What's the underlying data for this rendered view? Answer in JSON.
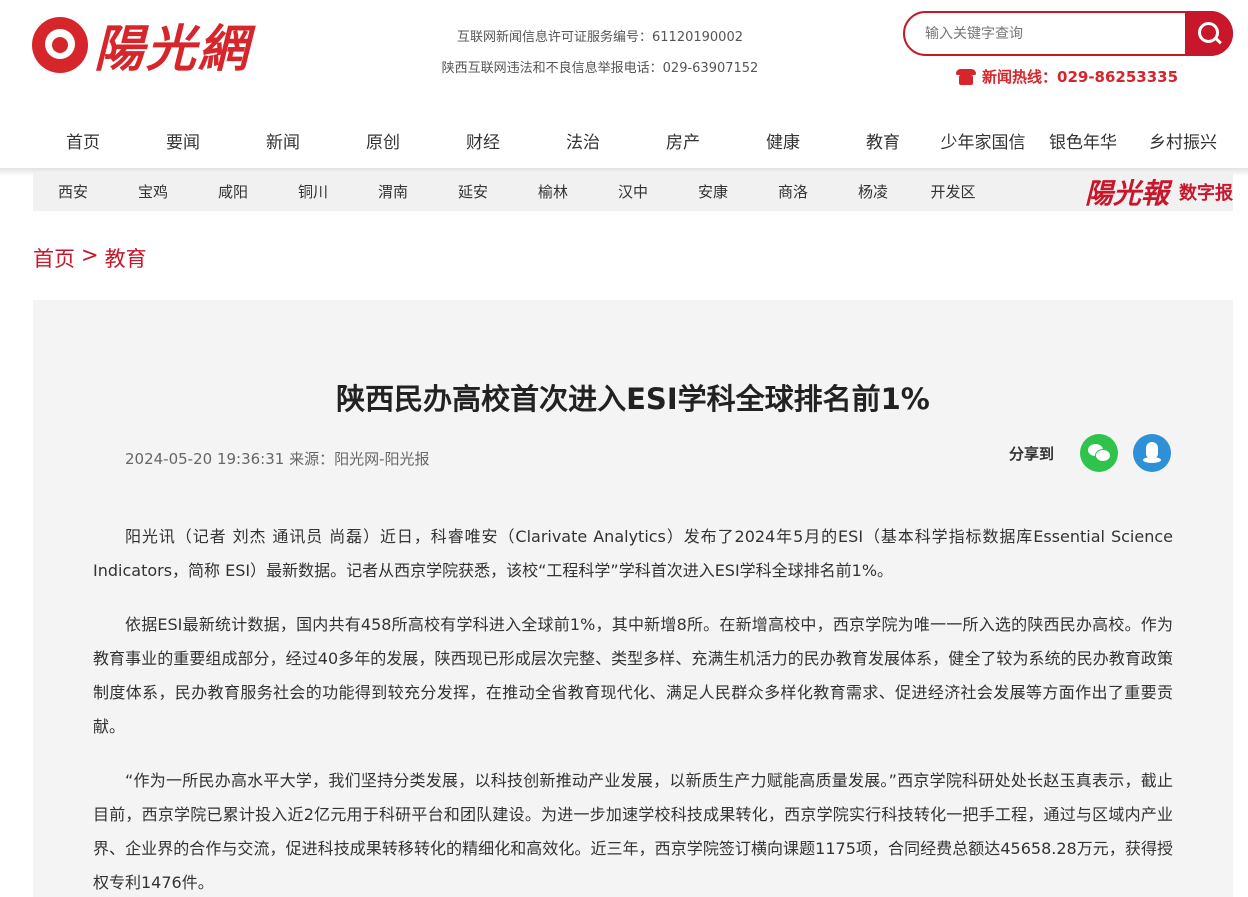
{
  "header": {
    "logo_text": "陽光網",
    "license_line1": "互联网新闻信息许可证服务编号：61120190002",
    "license_line2": "陕西互联网违法和不良信息举报电话：029-63907152",
    "search_placeholder": "输入关键字查询",
    "hotline_label": "新闻热线：",
    "hotline_number": "029-86253335"
  },
  "nav": [
    "首页",
    "要闻",
    "新闻",
    "原创",
    "财经",
    "法治",
    "房产",
    "健康",
    "教育",
    "少年家国信",
    "银色年华",
    "乡村振兴"
  ],
  "subnav": [
    "西安",
    "宝鸡",
    "咸阳",
    "铜川",
    "渭南",
    "延安",
    "榆林",
    "汉中",
    "安康",
    "商洛",
    "杨凌",
    "开发区"
  ],
  "digital": {
    "logo_text": "陽光報",
    "label": "数字报"
  },
  "breadcrumb": {
    "home": "首页",
    "sep": ">",
    "current": "教育"
  },
  "article": {
    "title": "陕西民办高校首次进入ESI学科全球排名前1%",
    "meta": "2024-05-20 19:36:31 来源：阳光网-阳光报",
    "share_label": "分享到",
    "paragraphs": [
      "阳光讯（记者 刘杰 通讯员 尚磊）近日，科睿唯安（Clarivate Analytics）发布了2024年5月的ESI（基本科学指标数据库Essential Science Indicators，简称 ESI）最新数据。记者从西京学院获悉，该校“工程科学”学科首次进入ESI学科全球排名前1%。",
      "依据ESI最新统计数据，国内共有458所高校有学科进入全球前1%，其中新增8所。在新增高校中，西京学院为唯一一所入选的陕西民办高校。作为教育事业的重要组成部分，经过40多年的发展，陕西现已形成层次完整、类型多样、充满生机活力的民办教育发展体系，健全了较为系统的民办教育政策制度体系，民办教育服务社会的功能得到较充分发挥，在推动全省教育现代化、满足人民群众多样化教育需求、促进经济社会发展等方面作出了重要贡献。",
      "“作为一所民办高水平大学，我们坚持分类发展，以科技创新推动产业发展，以新质生产力赋能高质量发展。”西京学院科研处处长赵玉真表示，截止目前，西京学院已累计投入近2亿元用于科研平台和团队建设。为进一步加速学校科技成果转化，西京学院实行科技转化一把手工程，通过与区域内产业界、企业界的合作与交流，促进科技成果转移转化的精细化和高效化。近三年，西京学院签订横向课题1175项，合同经费总额达45658.28万元，获得授权专利1476件。"
    ]
  }
}
